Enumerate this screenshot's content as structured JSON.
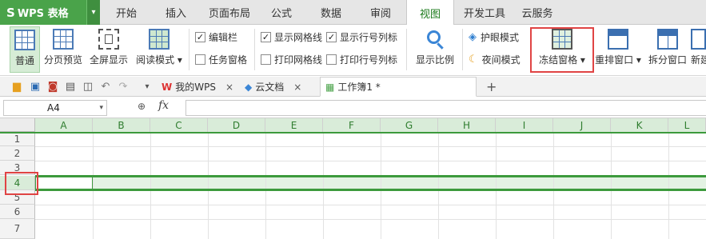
{
  "app": {
    "logo_glyph": "S",
    "title": "WPS 表格"
  },
  "tabs": [
    "开始",
    "插入",
    "页面布局",
    "公式",
    "数据",
    "审阅",
    "视图",
    "开发工具",
    "云服务"
  ],
  "active_tab": "视图",
  "ribbon": {
    "normal": "普通",
    "page_break": "分页预览",
    "fullscreen": "全屏显示",
    "reading_mode": "阅读模式",
    "edit_bar": "编辑栏",
    "task_pane": "任务窗格",
    "show_gridlines": "显示网格线",
    "print_gridlines": "打印网格线",
    "show_headers": "显示行号列标",
    "print_headers": "打印行号列标",
    "zoom": "显示比例",
    "eye_protect": "护眼模式",
    "night_mode": "夜间模式",
    "freeze_panes": "冻结窗格",
    "arrange_window": "重排窗口",
    "split_window": "拆分窗口",
    "new_window": "新建",
    "check_mark": "✓"
  },
  "doc_tabs": [
    {
      "label": "我的WPS",
      "close": "×"
    },
    {
      "label": "云文档",
      "close": "×"
    },
    {
      "label": "工作簿1 *",
      "close": ""
    }
  ],
  "add_tab": "+",
  "formula": {
    "cell_ref": "A4",
    "dropdown": "▾",
    "zoom_icon": "🔍",
    "fx": "fx"
  },
  "columns": [
    "A",
    "B",
    "C",
    "D",
    "E",
    "F",
    "G",
    "H",
    "I",
    "J",
    "K",
    "L"
  ],
  "rows": [
    "1",
    "2",
    "3",
    "4",
    "5",
    "6",
    "7"
  ],
  "selected_row": "4",
  "colors": {
    "accent": "#4aa34a",
    "highlight": "#e04444",
    "freeze_line": "#3c9a3c"
  }
}
